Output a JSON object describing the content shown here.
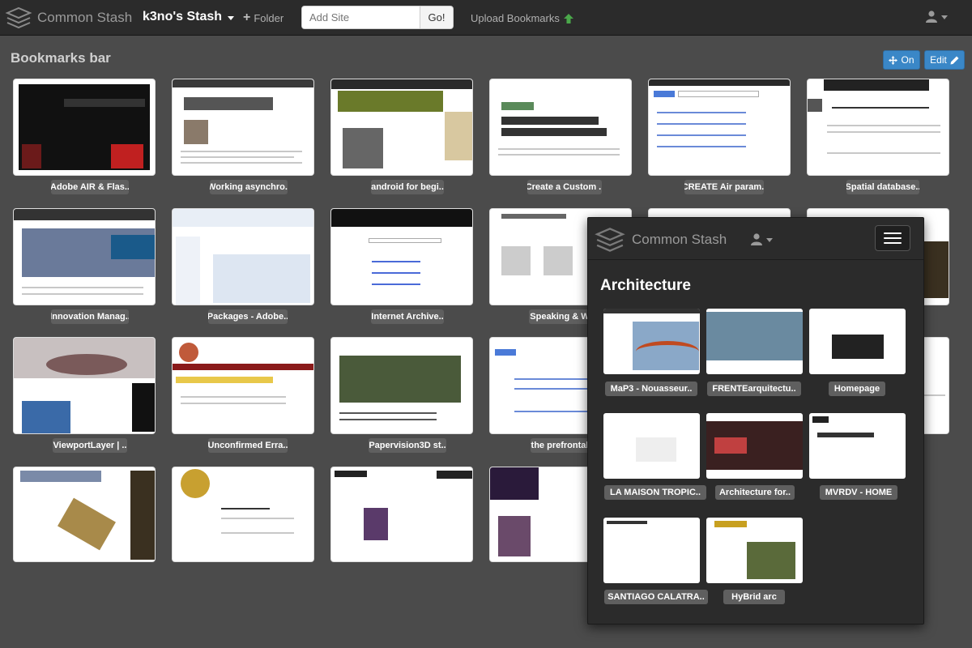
{
  "navbar": {
    "brand": "Common Stash",
    "stash_name": "k3no's Stash",
    "folder_label": "Folder",
    "add_site_placeholder": "Add Site",
    "go_label": "Go!",
    "upload_label": "Upload Bookmarks"
  },
  "header": {
    "title": "Bookmarks bar",
    "on_label": "On",
    "edit_label": "Edit"
  },
  "bookmarks": [
    {
      "label": "Adobe AIR & Flas.."
    },
    {
      "label": "Working asynchro.."
    },
    {
      "label": "android for begi.."
    },
    {
      "label": "Create a Custom .."
    },
    {
      "label": "CREATE Air param.."
    },
    {
      "label": "Spatial database.."
    },
    {
      "label": "Innovation Manag.."
    },
    {
      "label": "Packages - Adobe.."
    },
    {
      "label": "Internet Archive.."
    },
    {
      "label": "Speaking & Wr"
    },
    {
      "label": ""
    },
    {
      "label": ""
    },
    {
      "label": "ViewportLayer | .."
    },
    {
      "label": "Unconfirmed Erra.."
    },
    {
      "label": "Papervision3D st.."
    },
    {
      "label": "the prefrontal"
    },
    {
      "label": ""
    },
    {
      "label": ""
    },
    {
      "label": ""
    },
    {
      "label": ""
    },
    {
      "label": ""
    },
    {
      "label": ""
    },
    {
      "label": ""
    },
    {
      "label": ""
    }
  ],
  "panel": {
    "brand": "Common Stash",
    "title": "Architecture",
    "items": [
      {
        "label": "MaP3 - Nouasseur.."
      },
      {
        "label": "FRENTEarquitectu.."
      },
      {
        "label": "Homepage"
      },
      {
        "label": "LA MAISON TROPIC.."
      },
      {
        "label": "Architecture for.."
      },
      {
        "label": "MVRDV - HOME"
      },
      {
        "label": "SANTIAGO CALATRA.."
      },
      {
        "label": "HyBrid arc"
      }
    ]
  },
  "colors": {
    "background": "#4b4b4b",
    "navbar": "#2b2b2b",
    "accent_blue": "#3a87c7",
    "label_bg": "#5f5f5f"
  },
  "icons": {
    "brand": "stacked-boxes-icon",
    "folder_plus": "plus-icon",
    "upload": "recycle-arrow-icon",
    "user": "user-icon",
    "on": "move-arrows-icon",
    "edit": "pencil-icon",
    "menu": "hamburger-icon"
  }
}
